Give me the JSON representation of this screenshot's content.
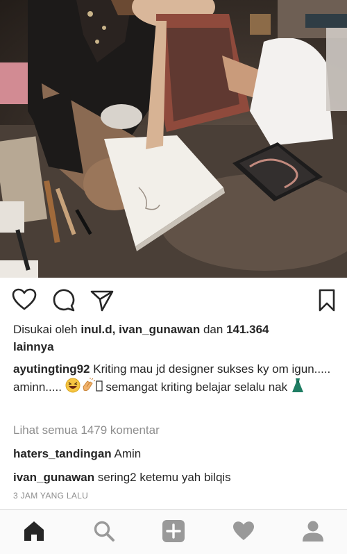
{
  "post": {
    "photo_description_icon": "post-photo",
    "likes": {
      "prefix": "Disukai oleh ",
      "user1": "inul.d",
      "sep": ", ",
      "user2": "ivan_gunawan",
      "mid": " dan ",
      "count": "141.364",
      "suffix": "lainnya"
    },
    "caption": {
      "user": "ayutingting92",
      "text1": " Kriting mau jd designer sukses ky om igun..... aminn..... ",
      "text2": " semangat kriting belajar selalu nak "
    },
    "view_all_comments": "Lihat semua 1479 komentar",
    "comments": [
      {
        "user": "haters_tandingan",
        "text": " Amin"
      },
      {
        "user": "ivan_gunawan",
        "text": " sering2  ketemu yah bilqis"
      }
    ],
    "timestamp": "3 JAM YANG LALU"
  },
  "actions": {
    "icons": [
      "heart-icon",
      "comment-icon",
      "share-icon",
      "bookmark-icon"
    ]
  },
  "nav": {
    "items": [
      "home-icon",
      "search-icon",
      "add-post-icon",
      "activity-heart-icon",
      "profile-icon"
    ]
  },
  "colors": {
    "text": "#262626",
    "secondary": "#8e8e8e",
    "nav_icon": "#999999",
    "nav_active": "#262626"
  }
}
